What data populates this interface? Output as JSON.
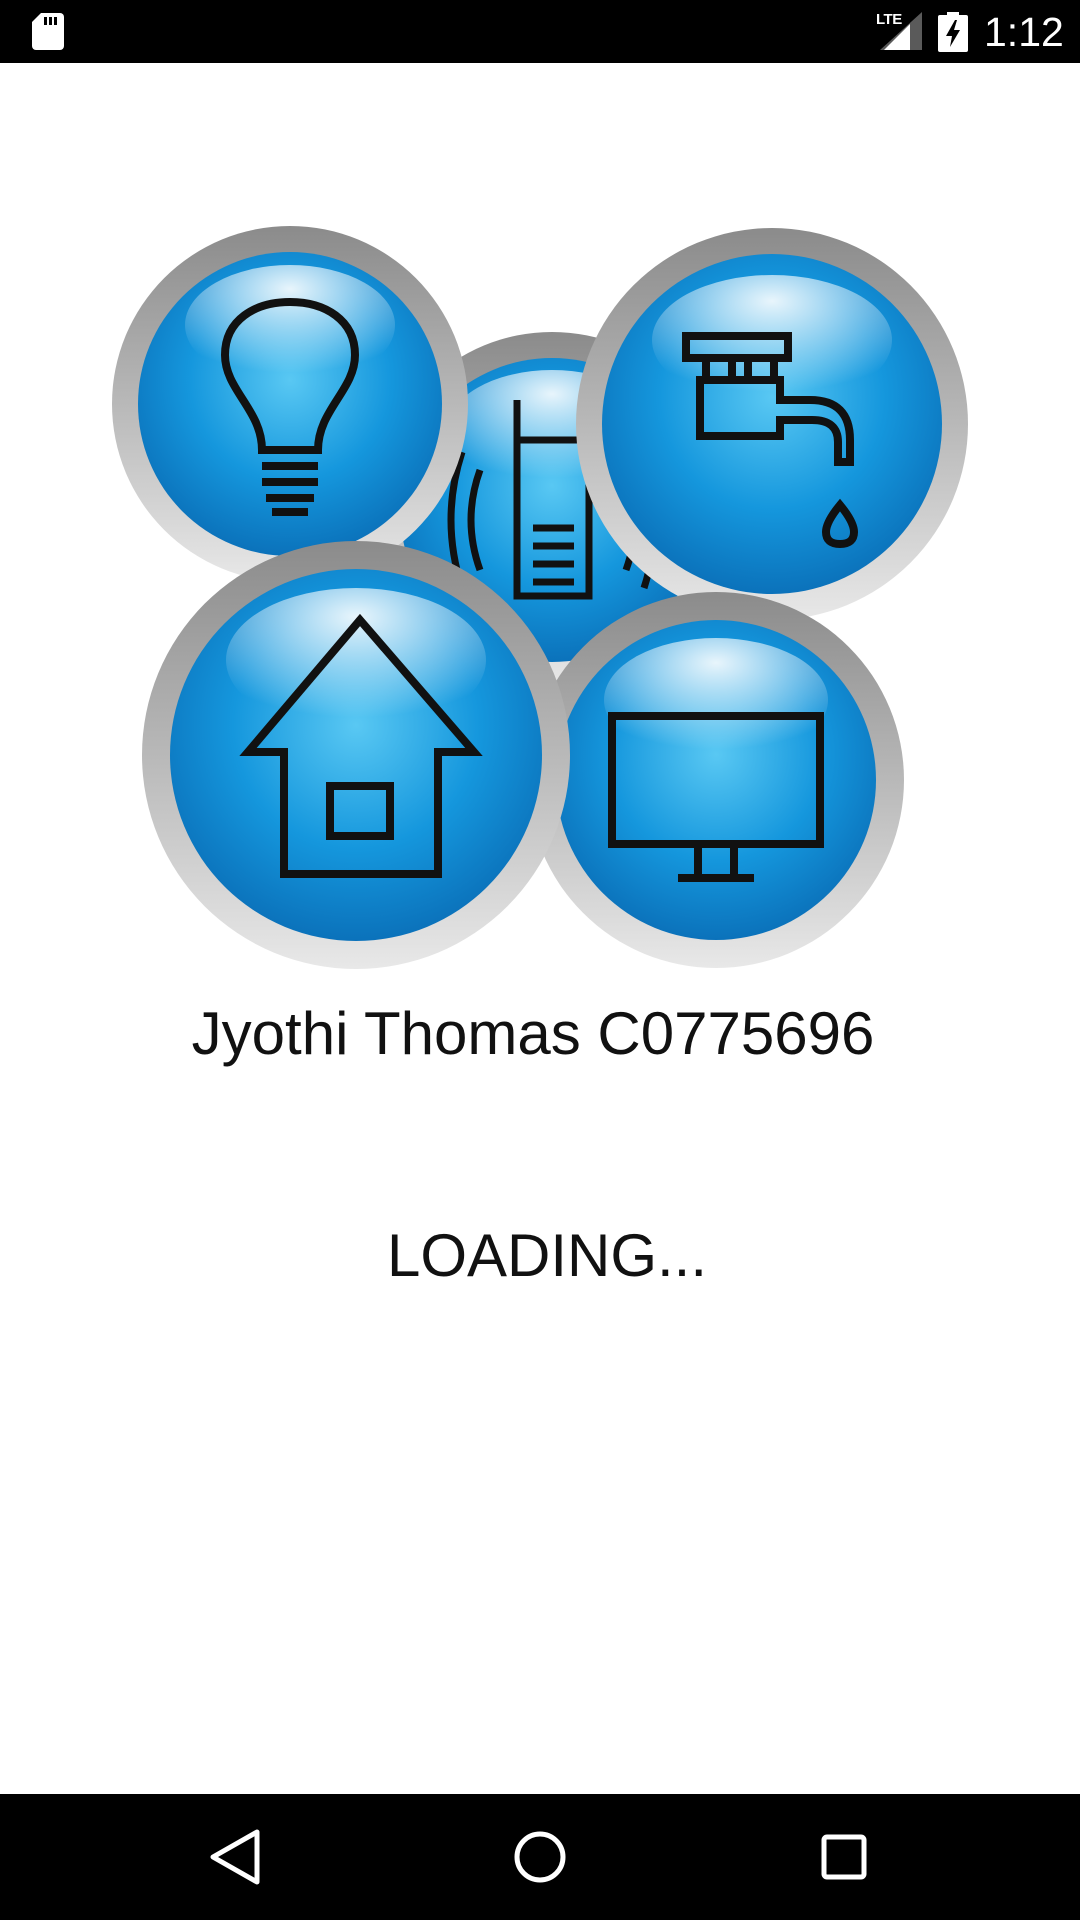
{
  "status_bar": {
    "network_label": "LTE",
    "time": "1:12",
    "icons": [
      "sd-card-icon",
      "signal-icon",
      "battery-charging-icon"
    ]
  },
  "main": {
    "logo_icons": [
      "lightbulb-icon",
      "mobile-signal-icon",
      "water-tap-icon",
      "house-icon",
      "television-icon"
    ],
    "student_name": "Jyothi Thomas C0775696",
    "loading_text": "LOADING..."
  },
  "nav_bar": {
    "buttons": [
      "back-button",
      "home-button",
      "recents-button"
    ]
  },
  "colors": {
    "button_blue": "#0a85d2",
    "button_light_blue": "#59c8f3",
    "ring_gray": "#9a9a9a",
    "bar_black": "#000000"
  }
}
